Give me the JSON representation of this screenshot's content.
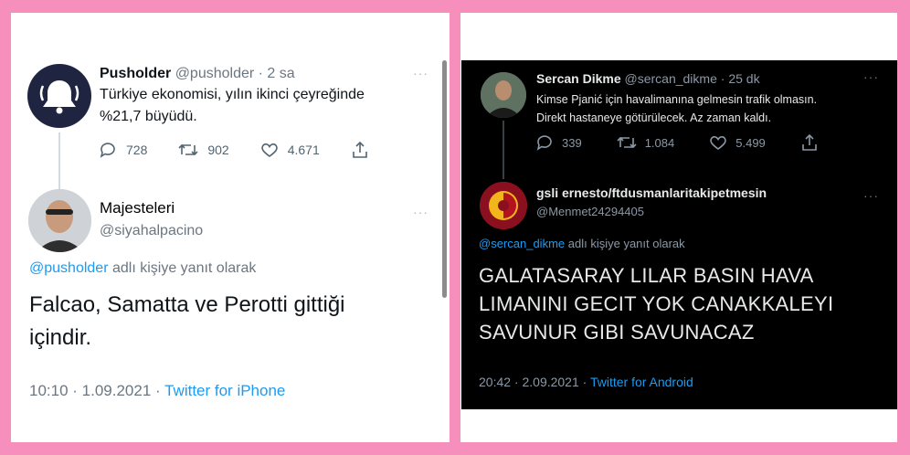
{
  "left_tweet": {
    "author": {
      "name": "Pusholder",
      "handle": "@pusholder",
      "time": "· 2 sa"
    },
    "text_lines": [
      "Türkiye ekonomisi, yılın ikinci çeyreğinde",
      "%21,7 büyüdü."
    ],
    "stats": {
      "replies": "728",
      "retweets": "902",
      "likes": "4.671"
    },
    "reply": {
      "name": "Majesteleri",
      "handle": "@siyahalpacino",
      "replying_mention": "@pusholder",
      "replying_text": "adlı kişiye yanıt olarak",
      "text_lines": [
        "Falcao, Samatta ve Perotti gittiği",
        "içindir."
      ],
      "time": "10:10 · 1.09.2021 ·",
      "source": "Twitter for iPhone"
    }
  },
  "right_tweet": {
    "author": {
      "name": "Sercan Dikme",
      "handle": "@sercan_dikme",
      "time": "· 25 dk"
    },
    "text_lines": [
      "Kimse Pjanić için havalimanına gelmesin trafik olmasın.",
      "Direkt hastaneye götürülecek. Az zaman kaldı."
    ],
    "stats": {
      "replies": "339",
      "retweets": "1.084",
      "likes": "5.499"
    },
    "reply": {
      "name": "gsli ernesto/ftdusmanlaritakipetmesin",
      "handle": "@Menmet24294405",
      "replying_mention": "@sercan_dikme",
      "replying_text": "adlı kişiye yanıt olarak",
      "text_lines": [
        "GALATASARAY LILAR BASIN HAVA",
        "LIMANINI GECIT YOK CANAKKALEYI",
        "SAVUNUR GIBI SAVUNACAZ"
      ],
      "time": "20:42 · 2.09.2021 ·",
      "source": "Twitter for Android"
    }
  },
  "more_label": "···",
  "colors": {
    "background": "#f78fbd",
    "accent": "#1d9bf0",
    "dark_bg": "#000000"
  },
  "icons": [
    "bell-icon",
    "reply-icon",
    "retweet-icon",
    "like-icon",
    "share-icon",
    "more-icon"
  ]
}
